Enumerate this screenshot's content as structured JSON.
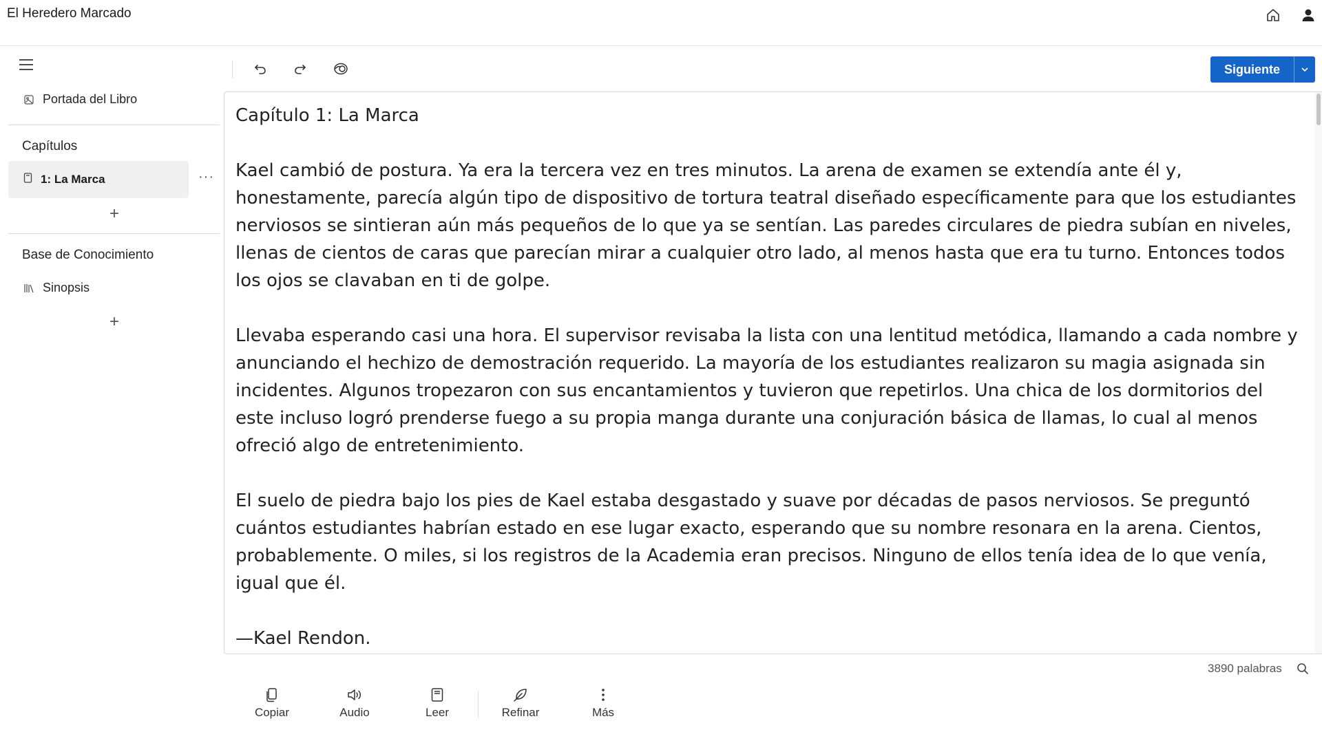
{
  "app": {
    "title": "El Heredero Marcado"
  },
  "sidebar": {
    "cover_label": "Portada del Libro",
    "chapters_heading": "Capítulos",
    "chapters": [
      {
        "label": "1: La Marca"
      }
    ],
    "more_label": "···",
    "knowledge_heading": "Base de Conocimiento",
    "knowledge_items": [
      {
        "label": "Sinopsis"
      }
    ],
    "add_label": "+"
  },
  "toolbar": {
    "next_label": "Siguiente"
  },
  "editor": {
    "title": "Capítulo 1: La Marca",
    "paragraphs": [
      "Kael cambió de postura. Ya era la tercera vez en tres minutos. La arena de examen se extendía ante él y, honestamente, parecía algún tipo de dispositivo de tortura teatral diseñado específicamente para que los estudiantes nerviosos se sintieran aún más pequeños de lo que ya se sentían. Las paredes circulares de piedra subían en niveles, llenas de cientos de caras que parecían mirar a cualquier otro lado, al menos hasta que era tu turno. Entonces todos los ojos se clavaban en ti de golpe.",
      "Llevaba esperando casi una hora. El supervisor revisaba la lista con una lentitud metódica, llamando a cada nombre y anunciando el hechizo de demostración requerido. La mayoría de los estudiantes realizaron su magia asignada sin incidentes. Algunos tropezaron con sus encantamientos y tuvieron que repetirlos. Una chica de los dormitorios del este incluso logró prenderse fuego a su propia manga durante una conjuración básica de llamas, lo cual al menos ofreció algo de entretenimiento.",
      "El suelo de piedra bajo los pies de Kael estaba desgastado y suave por décadas de pasos nerviosos. Se preguntó cuántos estudiantes habrían estado en ese lugar exacto, esperando que su nombre resonara en la arena. Cientos, probablemente. O miles, si los registros de la Academia eran precisos. Ninguno de ellos tenía idea de lo que venía, igual que él.",
      "—Kael Rendon."
    ]
  },
  "status": {
    "word_count": "3890 palabras"
  },
  "actions": [
    {
      "label": "Copiar",
      "icon": "copy-icon"
    },
    {
      "label": "Audio",
      "icon": "speaker-icon"
    },
    {
      "label": "Leer",
      "icon": "book-icon"
    },
    {
      "label": "Refinar",
      "icon": "feather-icon"
    },
    {
      "label": "Más",
      "icon": "more-vertical-icon"
    }
  ],
  "colors": {
    "accent": "#1565c8"
  }
}
